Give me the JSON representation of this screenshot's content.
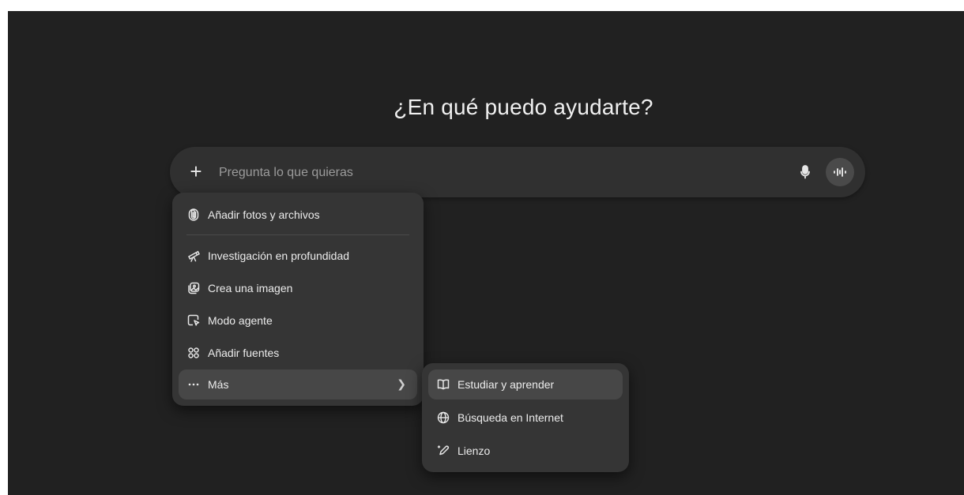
{
  "main": {
    "heading": "¿En qué puedo ayudarte?"
  },
  "composer": {
    "placeholder": "Pregunta lo que quieras",
    "plus_icon": "plus-icon",
    "mic_icon": "microphone-icon",
    "voice_icon": "voice-mode-icon"
  },
  "menu": {
    "items": [
      {
        "label": "Añadir fotos y archivos",
        "icon": "paperclip-icon"
      },
      {
        "label": "Investigación en profundidad",
        "icon": "telescope-icon"
      },
      {
        "label": "Crea una imagen",
        "icon": "image-icon"
      },
      {
        "label": "Modo agente",
        "icon": "agent-icon"
      },
      {
        "label": "Añadir fuentes",
        "icon": "sources-icon"
      },
      {
        "label": "Más",
        "icon": "more-icon"
      }
    ]
  },
  "submenu": {
    "items": [
      {
        "label": "Estudiar y aprender",
        "icon": "book-icon"
      },
      {
        "label": "Búsqueda en Internet",
        "icon": "globe-icon"
      },
      {
        "label": "Lienzo",
        "icon": "pencil-icon"
      }
    ]
  },
  "colors": {
    "background": "#212121",
    "surface": "#303030",
    "menu": "#353535",
    "highlight": "#474747"
  }
}
